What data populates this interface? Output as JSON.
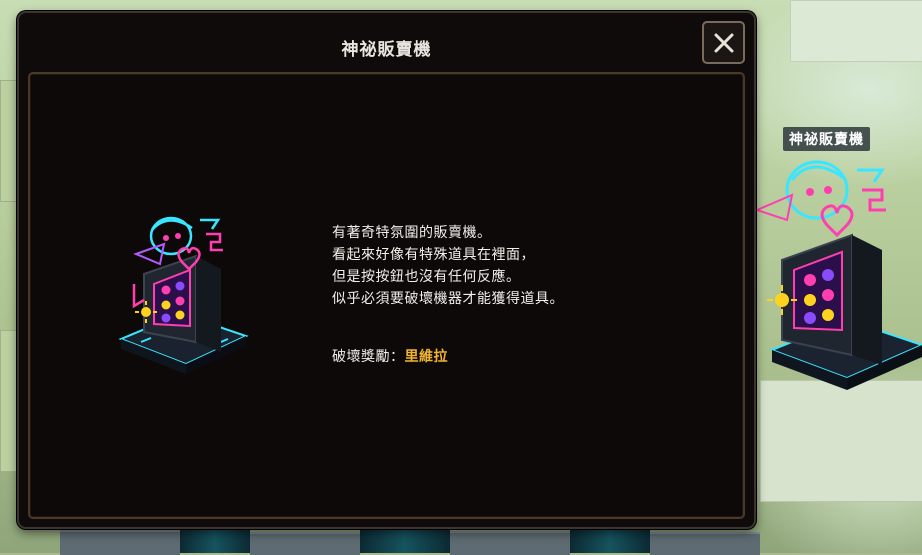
{
  "dialog": {
    "title": "神祕販賣機",
    "close_icon": "close-icon"
  },
  "item": {
    "icon": "neon-vending-machine-icon",
    "description_lines": [
      "有著奇特氛圍的販賣機。",
      "看起來好像有特殊道具在裡面，",
      "但是按按鈕也沒有任何反應。",
      "似乎必須要破壞機器才能獲得道具。"
    ],
    "reward_label": "破壞獎勵：",
    "reward_value": "里維拉"
  },
  "world": {
    "npc_label": "神祕販賣機",
    "object_icon": "neon-vending-machine-icon"
  },
  "colors": {
    "dialog_bg": "#0f0b0a",
    "panel_border": "#4c3828",
    "text": "#f2efea",
    "reward_highlight": "#f2b431",
    "neon_pink": "#ff3fb0",
    "neon_cyan": "#39e6ff",
    "neon_yellow": "#ffd21f"
  }
}
